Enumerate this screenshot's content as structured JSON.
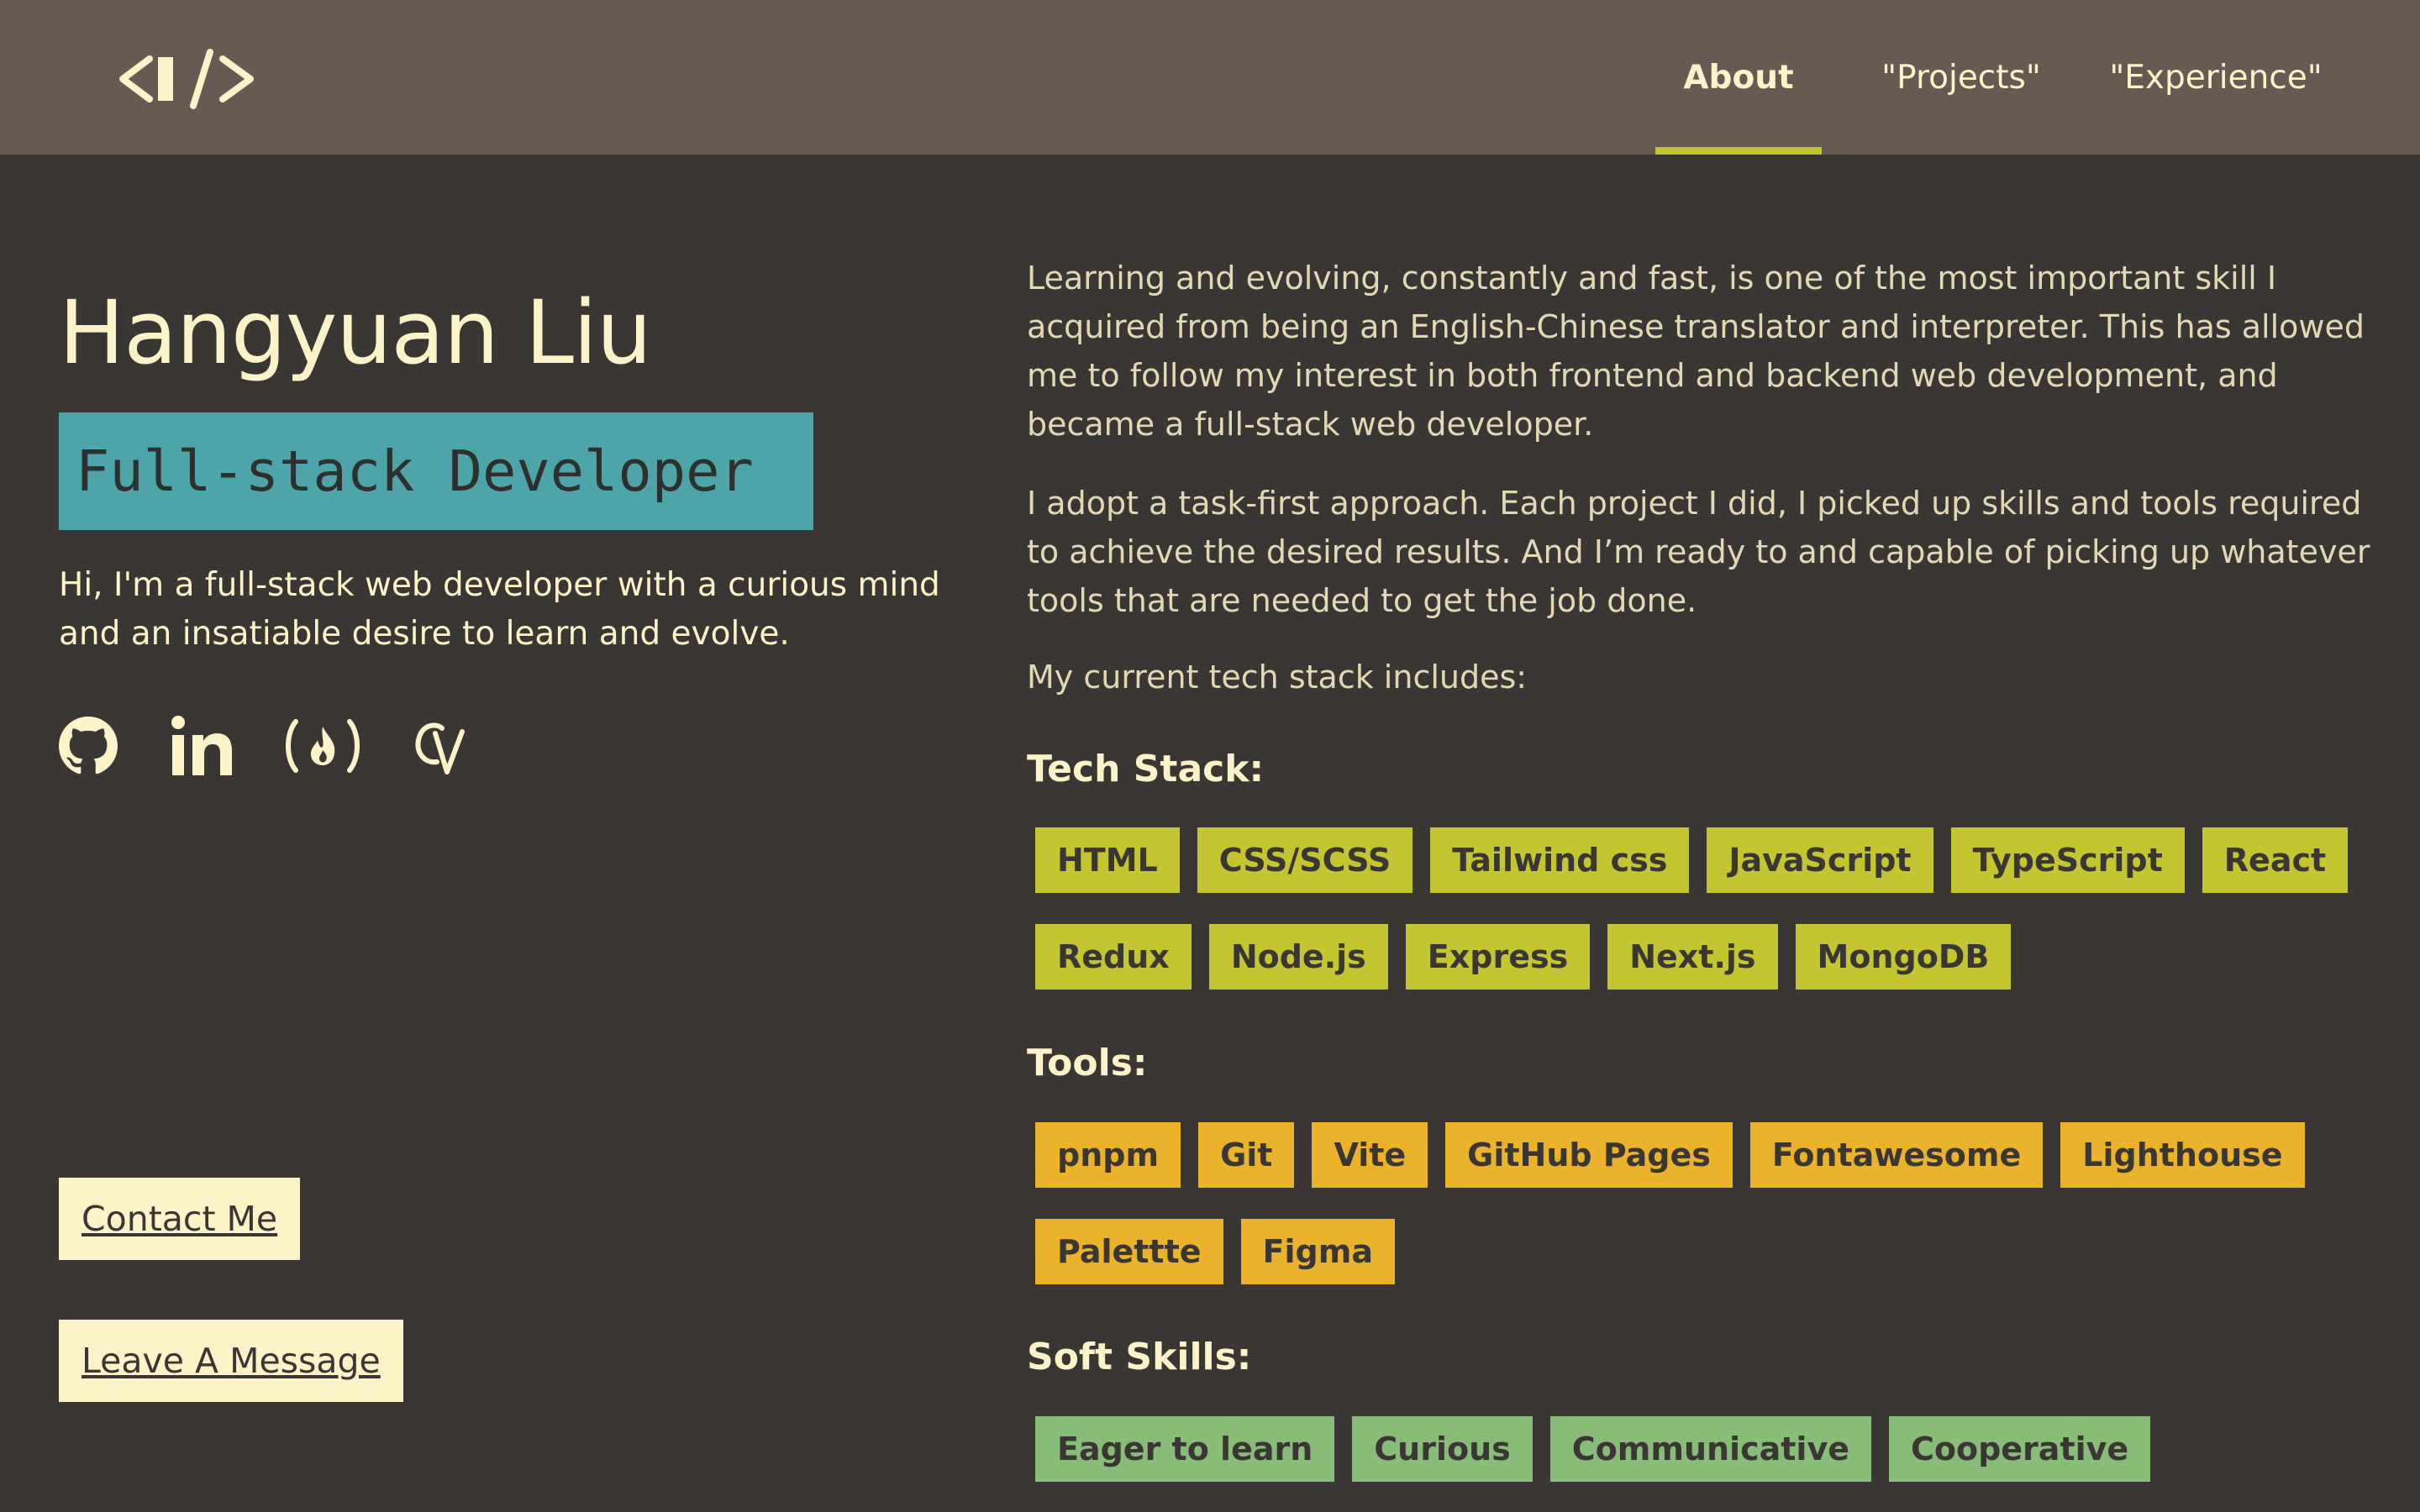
{
  "header": {
    "logo_label": "</>",
    "nav": [
      {
        "label": "About",
        "active": true
      },
      {
        "label": "\"Projects\"",
        "active": false
      },
      {
        "label": "\"Experience\"",
        "active": false
      }
    ]
  },
  "profile": {
    "name": "Hangyuan Liu",
    "role": "Full-stack Developer",
    "intro": "Hi, I'm a full-stack web developer with a curious mind and an insatiable desire to learn and evolve.",
    "socials": [
      "github-icon",
      "linkedin-icon",
      "freecodecamp-icon",
      "cv-icon"
    ],
    "contact_label": "Contact Me",
    "message_label": "Leave A Message"
  },
  "about": {
    "p1": "Learning and evolving, constantly and fast, is one of the most important skill I acquired from being an English-Chinese translator and interpreter. This has allowed me to follow my interest in both frontend and backend web development, and became a full-stack web developer.",
    "p2": "I adopt a task-first approach. Each project I did, I picked up skills and tools required to achieve the desired results. And I’m ready to and capable of picking up whatever tools that are needed to get the job done.",
    "p3": "My current tech stack includes:",
    "tech_title": "Tech Stack:",
    "tech_row1": [
      "HTML",
      "CSS/SCSS",
      "Tailwind css",
      "JavaScript",
      "TypeScript",
      "React"
    ],
    "tech_row2": [
      "Redux",
      "Node.js",
      "Express",
      "Next.js",
      "MongoDB"
    ],
    "tools_title": "Tools:",
    "tools_row1": [
      "pnpm",
      "Git",
      "Vite",
      "GitHub Pages",
      "Fontawesome",
      "Lighthouse"
    ],
    "tools_row2": [
      "Palettte",
      "Figma"
    ],
    "soft_title": "Soft Skills:",
    "soft_row1": [
      "Eager to learn",
      "Curious",
      "Communicative",
      "Cooperative"
    ]
  },
  "colors": {
    "background": "#3a3634",
    "header": "#655b53",
    "cream": "#fdf3c8",
    "teal": "#4ea5a9",
    "tech": "#c4c531",
    "tool": "#ebb32b",
    "soft": "#87bd78"
  }
}
